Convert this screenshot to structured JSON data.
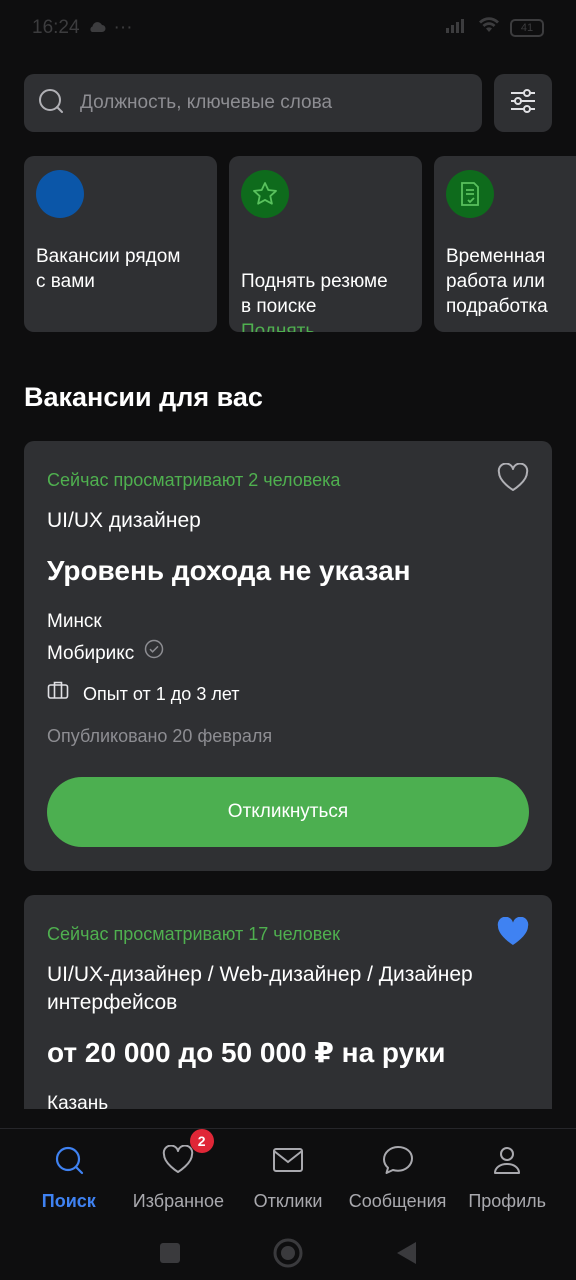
{
  "status": {
    "time": "16:24",
    "battery": "41"
  },
  "search": {
    "placeholder": "Должность, ключевые слова"
  },
  "quick_cards": [
    {
      "label": "Вакансии рядом\nс вами",
      "action": ""
    },
    {
      "label": "Поднять резюме\nв поиске",
      "action": "Поднять"
    },
    {
      "label": "Временная\nработа или\nподработка",
      "action": ""
    }
  ],
  "section": {
    "title": "Вакансии для вас"
  },
  "vacancies": [
    {
      "viewers": "Сейчас просматривают 2 человека",
      "title": "UI/UX дизайнер",
      "salary": "Уровень дохода не указан",
      "city": "Минск",
      "company": "Мобирикс",
      "experience": "Опыт от 1 до 3 лет",
      "published": "Опубликовано 20 февраля",
      "apply_label": "Откликнуться",
      "favorite": false
    },
    {
      "viewers": "Сейчас просматривают 17 человек",
      "title": "UI/UX-дизайнер / Web-дизайнер / Дизайнер интерфейсов",
      "salary": "от 20 000 до 50 000 ₽ на руки",
      "city": "Казань",
      "favorite": true
    }
  ],
  "nav": {
    "items": [
      {
        "label": "Поиск",
        "icon": "search-icon",
        "active": true
      },
      {
        "label": "Избранное",
        "icon": "heart-icon",
        "badge": "2"
      },
      {
        "label": "Отклики",
        "icon": "envelope-icon"
      },
      {
        "label": "Сообщения",
        "icon": "chat-icon"
      },
      {
        "label": "Профиль",
        "icon": "person-icon"
      }
    ]
  },
  "colors": {
    "background": "#0e0e0f",
    "card": "#2f3033",
    "accent_green": "#4caf50",
    "accent_blue": "#3f82f2",
    "badge_red": "#e02737"
  }
}
